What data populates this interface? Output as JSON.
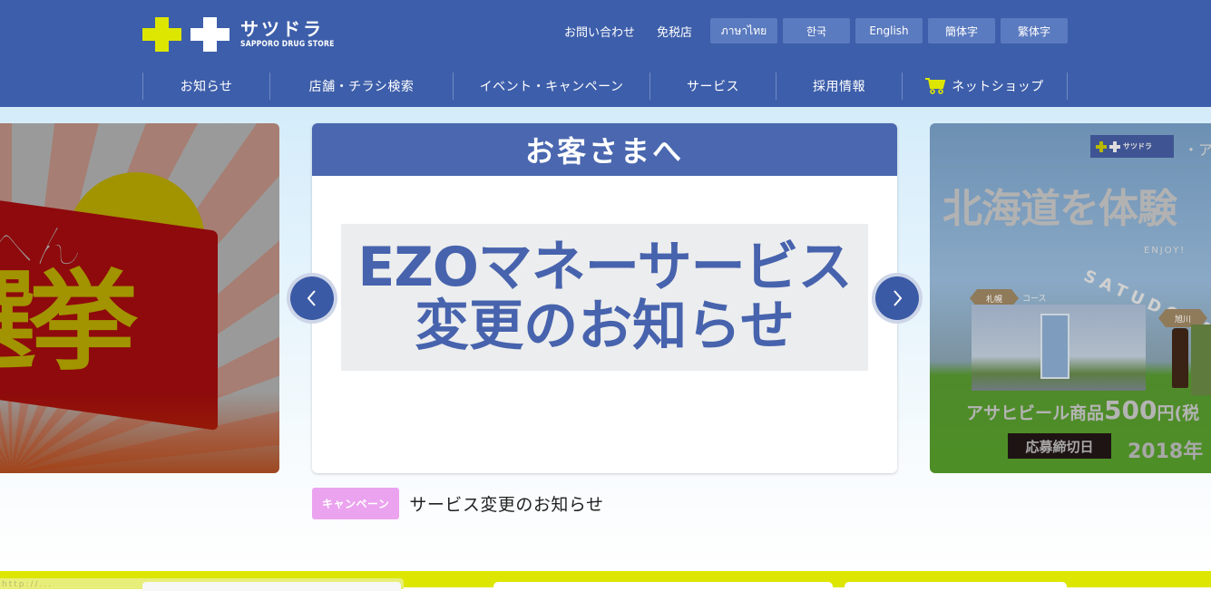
{
  "brand": {
    "name_kana": "サツドラ",
    "name_en": "SAPPORO DRUG STORE",
    "colors": {
      "header": "#3d5eaa",
      "accent_yellow": "#dde600",
      "lang_button": "#5b7bc0",
      "campaign_badge": "#eba3ef"
    }
  },
  "header": {
    "util_links": [
      {
        "label": "お問い合わせ"
      },
      {
        "label": "免税店"
      }
    ],
    "languages": [
      {
        "label": "ภาษาไทย"
      },
      {
        "label": "한국"
      },
      {
        "label": "English"
      },
      {
        "label": "簡体字"
      },
      {
        "label": "繁体字"
      }
    ],
    "nav": [
      {
        "label": "お知らせ"
      },
      {
        "label": "店舗・チラシ検索"
      },
      {
        "label": "イベント・キャンペーン"
      },
      {
        "label": "サービス"
      },
      {
        "label": "採用情報"
      },
      {
        "label": "ネットショップ",
        "icon": "cart-icon"
      }
    ]
  },
  "carousel": {
    "prev_icon": "chevron-left-icon",
    "next_icon": "chevron-right-icon",
    "left_slide": {
      "title_top": "べん",
      "title_main": "選挙"
    },
    "current_slide": {
      "banner": "お客さまへ",
      "notice_line1": "EZOマネーサービス",
      "notice_line2": "変更のお知らせ"
    },
    "right_slide": {
      "mini_logo": "サツドラ",
      "suffix": "・ア",
      "headline": "北海道を体験",
      "enjoy": "ENJOY!",
      "satudora": "SATUDORA",
      "course_sapporo": "札幌",
      "course_asahikawa": "旭川",
      "course_label": "コース",
      "promo_prefix": "アサヒビール商品",
      "promo_amount": "500",
      "promo_suffix": "円(税",
      "deadline_label": "応募締切日",
      "year": "2018年"
    },
    "caption": {
      "badge": "キャンペーン",
      "title": "サービス変更のお知らせ"
    }
  },
  "footer_peek": {
    "url_ghost": "http://..."
  }
}
